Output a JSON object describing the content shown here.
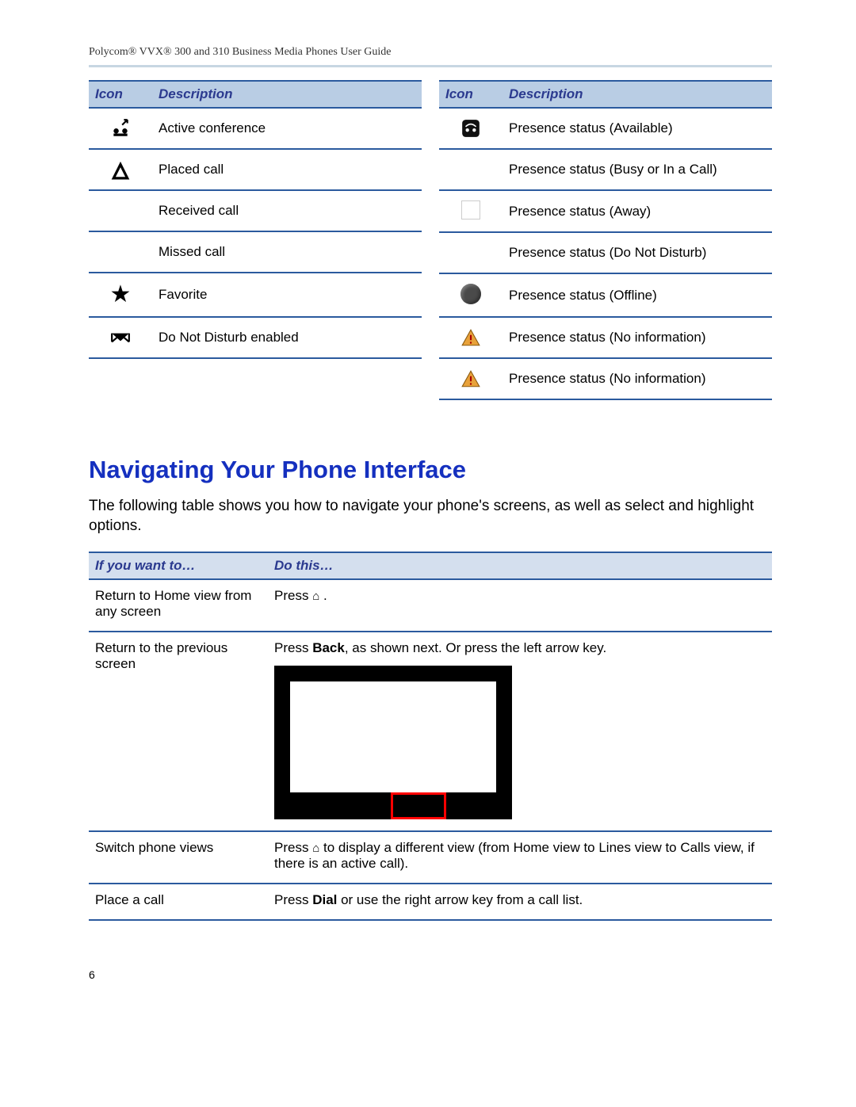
{
  "header": "Polycom® VVX® 300 and 310 Business Media Phones User Guide",
  "page_number": "6",
  "icon_headers": {
    "icon": "Icon",
    "desc": "Description"
  },
  "left_rows": [
    {
      "icon_name": "conference-icon",
      "glyph": "conf",
      "desc": "Active conference"
    },
    {
      "icon_name": "placed-call-icon",
      "glyph": "placed",
      "desc": "Placed call"
    },
    {
      "icon_name": "received-call-icon",
      "glyph": "blank",
      "desc": "Received call"
    },
    {
      "icon_name": "missed-call-icon",
      "glyph": "blank",
      "desc": "Missed call"
    },
    {
      "icon_name": "favorite-icon",
      "glyph": "star",
      "desc": "Favorite"
    },
    {
      "icon_name": "dnd-enabled-icon",
      "glyph": "dnd",
      "desc": "Do Not Disturb enabled"
    }
  ],
  "right_rows": [
    {
      "icon_name": "presence-available-icon",
      "glyph": "avail",
      "desc": "Presence status (Available)"
    },
    {
      "icon_name": "presence-busy-icon",
      "glyph": "none",
      "desc": "Presence status (Busy or In a Call)"
    },
    {
      "icon_name": "presence-away-icon",
      "glyph": "box",
      "desc": "Presence status (Away)"
    },
    {
      "icon_name": "presence-dnd-icon",
      "glyph": "none",
      "desc": "Presence status (Do Not Disturb)"
    },
    {
      "icon_name": "presence-offline-icon",
      "glyph": "dot",
      "desc": "Presence status (Offline)"
    },
    {
      "icon_name": "presence-noinfo-icon",
      "glyph": "warn",
      "desc": "Presence status (No information)"
    },
    {
      "icon_name": "presence-noinfo2-icon",
      "glyph": "warn",
      "desc": "Presence status (No information)"
    }
  ],
  "section_heading": "Navigating Your Phone Interface",
  "section_intro": "The following table shows you how to navigate your phone's screens, as well as select and highlight options.",
  "nav_headers": {
    "want": "If you want to…",
    "do": "Do this…"
  },
  "nav_rows": {
    "r1_want": "Return to Home view from any screen",
    "r1_do_pre": "Press  ",
    "r1_do_post": " .",
    "r2_want": "Return to the previous screen",
    "r2_do_pre": "Press ",
    "r2_do_bold": "Back",
    "r2_do_post": ", as shown next. Or press the left arrow key.",
    "r3_want": "Switch phone views",
    "r3_do_pre": "Press  ",
    "r3_do_post": "  to display a different view (from Home view to Lines view to Calls view, if there is an active call).",
    "r4_want": "Place a call",
    "r4_do_pre": "Press ",
    "r4_do_bold": "Dial",
    "r4_do_post": " or use the right arrow key from a call list."
  }
}
